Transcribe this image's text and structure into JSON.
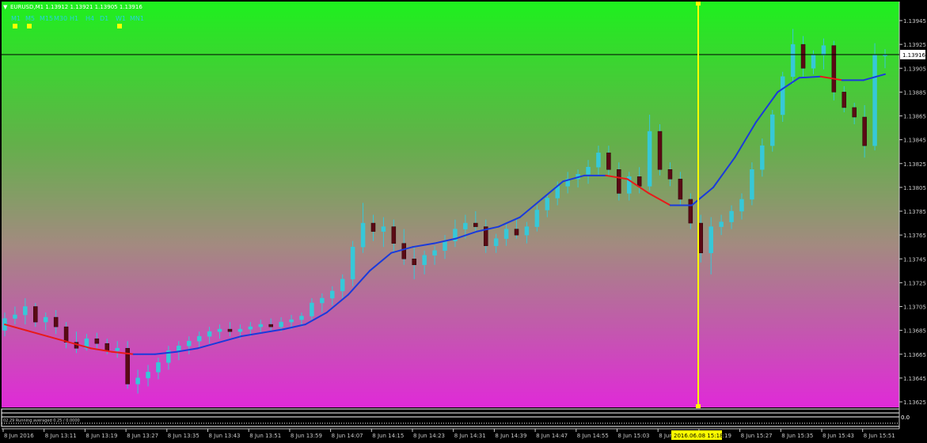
{
  "symbol_header": "EURUSD,M1  1.13912 1.13921 1.13905 1.13916",
  "timeframes": [
    "M1",
    "M5",
    "M15",
    "M30",
    "H1",
    "H4",
    "D1",
    "W1",
    "MN1"
  ],
  "timeframe_markers": [
    "M1",
    "M5",
    "W1"
  ],
  "indicator_label": "02.29 Running averaged 0.25 / 0.0000",
  "price_axis_labels": [
    "1.13945",
    "1.13925",
    "1.13905",
    "1.13885",
    "1.13865",
    "1.13845",
    "1.13825",
    "1.13805",
    "1.13785",
    "1.13765",
    "1.13745",
    "1.13725",
    "1.13705",
    "1.13685",
    "1.13665",
    "1.13645",
    "1.13625"
  ],
  "current_price_label": "1.13916",
  "time_axis_labels": [
    "8 Jun 2016",
    "8 Jun 13:11",
    "8 Jun 13:19",
    "8 Jun 13:27",
    "8 Jun 13:35",
    "8 Jun 13:43",
    "8 Jun 13:51",
    "8 Jun 13:59",
    "8 Jun 14:07",
    "8 Jun 14:15",
    "8 Jun 14:23",
    "8 Jun 14:31",
    "8 Jun 14:39",
    "8 Jun 14:47",
    "8 Jun 14:55",
    "8 Jun 15:03",
    "8 Jun 15:11",
    "8 Jun 15:19",
    "8 Jun 15:27",
    "8 Jun 15:35",
    "8 Jun 15:43",
    "8 Jun 15:51"
  ],
  "crosshair_time_label": "2016.06.08 15:18",
  "subwindow_label": "",
  "colors": {
    "bg_top": "#1ef01e",
    "bg_bottom": "#e02ad8",
    "bull_wick": "#36c8d8",
    "bear_body": "#5a0a14",
    "ma_up": "#1a3adc",
    "ma_down": "#e81a1a",
    "crosshair": "#ffff00",
    "marker": "#ffff00",
    "timeframe_text": "#28d0e0"
  },
  "chart_data": {
    "type": "candlestick",
    "symbol": "EURUSD",
    "timeframe": "M1",
    "ylim": [
      1.1362,
      1.1396
    ],
    "candles": [
      [
        1.13685,
        1.137,
        1.1368,
        1.13695
      ],
      [
        1.13695,
        1.13705,
        1.1369,
        1.13698
      ],
      [
        1.13698,
        1.13712,
        1.1369,
        1.13705
      ],
      [
        1.13705,
        1.13708,
        1.13688,
        1.13692
      ],
      [
        1.13692,
        1.137,
        1.13685,
        1.13696
      ],
      [
        1.13696,
        1.13702,
        1.13682,
        1.13688
      ],
      [
        1.13688,
        1.13692,
        1.1367,
        1.13675
      ],
      [
        1.13675,
        1.13684,
        1.13666,
        1.1367
      ],
      [
        1.1367,
        1.13682,
        1.13668,
        1.13678
      ],
      [
        1.13678,
        1.13683,
        1.1367,
        1.13674
      ],
      [
        1.13674,
        1.13678,
        1.13665,
        1.13668
      ],
      [
        1.13668,
        1.13676,
        1.13662,
        1.1367
      ],
      [
        1.1367,
        1.13676,
        1.13636,
        1.1364
      ],
      [
        1.1364,
        1.13652,
        1.13632,
        1.13645
      ],
      [
        1.13645,
        1.13656,
        1.13638,
        1.1365
      ],
      [
        1.1365,
        1.13662,
        1.13644,
        1.13658
      ],
      [
        1.13658,
        1.13672,
        1.13652,
        1.13668
      ],
      [
        1.13668,
        1.13676,
        1.1366,
        1.13672
      ],
      [
        1.13672,
        1.1368,
        1.13665,
        1.13676
      ],
      [
        1.13676,
        1.13684,
        1.1367,
        1.1368
      ],
      [
        1.1368,
        1.13688,
        1.13674,
        1.13684
      ],
      [
        1.13684,
        1.1369,
        1.13678,
        1.13686
      ],
      [
        1.13686,
        1.13692,
        1.1368,
        1.13684
      ],
      [
        1.13684,
        1.1369,
        1.13678,
        1.13686
      ],
      [
        1.13686,
        1.13692,
        1.1368,
        1.13688
      ],
      [
        1.13688,
        1.13694,
        1.13682,
        1.1369
      ],
      [
        1.1369,
        1.13695,
        1.13684,
        1.13688
      ],
      [
        1.13688,
        1.13696,
        1.13684,
        1.13692
      ],
      [
        1.13692,
        1.13698,
        1.13686,
        1.13694
      ],
      [
        1.13694,
        1.137,
        1.13688,
        1.13697
      ],
      [
        1.13697,
        1.13712,
        1.13694,
        1.13708
      ],
      [
        1.13708,
        1.13716,
        1.137,
        1.13712
      ],
      [
        1.13712,
        1.13722,
        1.13706,
        1.13718
      ],
      [
        1.13718,
        1.13732,
        1.13712,
        1.13728
      ],
      [
        1.13728,
        1.1376,
        1.13722,
        1.13755
      ],
      [
        1.13755,
        1.13792,
        1.1375,
        1.13775
      ],
      [
        1.13775,
        1.13782,
        1.1376,
        1.13768
      ],
      [
        1.13768,
        1.1378,
        1.13755,
        1.13772
      ],
      [
        1.13772,
        1.13778,
        1.1375,
        1.13758
      ],
      [
        1.13758,
        1.1377,
        1.1374,
        1.13745
      ],
      [
        1.13745,
        1.13755,
        1.13728,
        1.1374
      ],
      [
        1.1374,
        1.13752,
        1.13732,
        1.13748
      ],
      [
        1.13748,
        1.13756,
        1.1374,
        1.13752
      ],
      [
        1.13752,
        1.13765,
        1.13745,
        1.1376
      ],
      [
        1.1376,
        1.13778,
        1.13755,
        1.1377
      ],
      [
        1.1377,
        1.13782,
        1.13762,
        1.13775
      ],
      [
        1.13775,
        1.13785,
        1.13768,
        1.13772
      ],
      [
        1.13772,
        1.13778,
        1.1375,
        1.13756
      ],
      [
        1.13756,
        1.13766,
        1.1375,
        1.13762
      ],
      [
        1.13762,
        1.13775,
        1.13756,
        1.1377
      ],
      [
        1.1377,
        1.13778,
        1.13762,
        1.13765
      ],
      [
        1.13765,
        1.13776,
        1.13758,
        1.13772
      ],
      [
        1.13772,
        1.1379,
        1.13768,
        1.13786
      ],
      [
        1.13786,
        1.138,
        1.1378,
        1.13796
      ],
      [
        1.13796,
        1.1381,
        1.1379,
        1.13806
      ],
      [
        1.13806,
        1.13818,
        1.138,
        1.13812
      ],
      [
        1.13812,
        1.1382,
        1.13805,
        1.13816
      ],
      [
        1.13816,
        1.13828,
        1.13808,
        1.13822
      ],
      [
        1.13822,
        1.1384,
        1.13815,
        1.13834
      ],
      [
        1.13834,
        1.1384,
        1.13815,
        1.1382
      ],
      [
        1.1382,
        1.13826,
        1.13794,
        1.138
      ],
      [
        1.138,
        1.13818,
        1.13794,
        1.13814
      ],
      [
        1.13814,
        1.13822,
        1.138,
        1.13806
      ],
      [
        1.13806,
        1.13866,
        1.13802,
        1.13852
      ],
      [
        1.13852,
        1.13858,
        1.13815,
        1.1382
      ],
      [
        1.1382,
        1.13826,
        1.13806,
        1.13812
      ],
      [
        1.13812,
        1.13818,
        1.1379,
        1.13795
      ],
      [
        1.13795,
        1.138,
        1.1377,
        1.13775
      ],
      [
        1.13775,
        1.13782,
        1.13742,
        1.1375
      ],
      [
        1.1375,
        1.1378,
        1.13732,
        1.13772
      ],
      [
        1.13772,
        1.13782,
        1.13765,
        1.13776
      ],
      [
        1.13776,
        1.1379,
        1.1377,
        1.13785
      ],
      [
        1.13785,
        1.138,
        1.13778,
        1.13795
      ],
      [
        1.13795,
        1.13826,
        1.1379,
        1.1382
      ],
      [
        1.1382,
        1.13846,
        1.13814,
        1.1384
      ],
      [
        1.1384,
        1.1387,
        1.13835,
        1.13866
      ],
      [
        1.13866,
        1.13902,
        1.1386,
        1.13898
      ],
      [
        1.13898,
        1.13938,
        1.13892,
        1.13925
      ],
      [
        1.13925,
        1.13932,
        1.13898,
        1.13905
      ],
      [
        1.13905,
        1.1392,
        1.139,
        1.13916
      ],
      [
        1.13916,
        1.1393,
        1.13904,
        1.13924
      ],
      [
        1.13924,
        1.13928,
        1.13878,
        1.13885
      ],
      [
        1.13885,
        1.1389,
        1.13868,
        1.13872
      ],
      [
        1.13872,
        1.13876,
        1.13858,
        1.13864
      ],
      [
        1.13864,
        1.13874,
        1.1383,
        1.1384
      ],
      [
        1.1384,
        1.13926,
        1.13836,
        1.13916
      ],
      [
        1.13916,
        1.13921,
        1.13905,
        1.13916
      ]
    ],
    "ma_values": [
      1.1369,
      1.13685,
      1.1368,
      1.13675,
      1.1367,
      1.13667,
      1.13665,
      1.13665,
      1.13667,
      1.1367,
      1.13675,
      1.1368,
      1.13683,
      1.13686,
      1.1369,
      1.137,
      1.13715,
      1.13735,
      1.1375,
      1.13755,
      1.13758,
      1.13762,
      1.13768,
      1.13772,
      1.1378,
      1.13795,
      1.1381,
      1.13815,
      1.13815,
      1.13812,
      1.138,
      1.1379,
      1.1379,
      1.13805,
      1.1383,
      1.1386,
      1.13885,
      1.13897,
      1.13898,
      1.13895,
      1.13895,
      1.139
    ]
  }
}
